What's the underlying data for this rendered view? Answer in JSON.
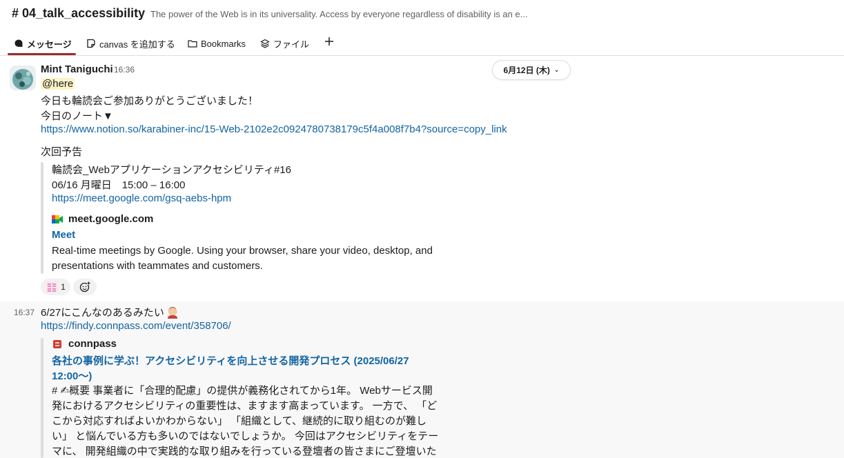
{
  "header": {
    "channel_title": "# 04_talk_accessibility",
    "channel_description": "The power of the Web is in its universality. Access by everyone regardless of disability is an e..."
  },
  "tabs": [
    {
      "label": "メッセージ",
      "icon": "message-icon"
    },
    {
      "label": "canvas を追加する",
      "icon": "canvas-icon"
    },
    {
      "label": "Bookmarks",
      "icon": "folder-icon"
    },
    {
      "label": "ファイル",
      "icon": "layers-icon"
    }
  ],
  "date_pill": "6月12日 (木)",
  "message1": {
    "sender": "Mint Taniguchi",
    "time": "16:36",
    "mention": "@here",
    "line1": "今日も輪読会ご参加ありがとうございました！",
    "line2": "今日のノート▼",
    "notion_link": "https://www.notion.so/karabiner-inc/15-Web-2102e2c0924780738179c5f4a008f7b4?source=copy_link",
    "next_label": "次回予告",
    "quote": {
      "title": "輪読会_Webアプリケーションアクセシビリティ#16",
      "datetime": "06/16 月曜日　15:00 – 16:00",
      "meet_link": "https://meet.google.com/gsq-aebs-hpm"
    },
    "unfurl": {
      "domain": "meet.google.com",
      "title": "Meet",
      "description": "Real-time meetings by Google. Using your browser, share your video, desktop, and presentations with teammates and customers."
    },
    "reaction": {
      "count": "1",
      "icon": "custom-emoji-icon"
    }
  },
  "message2": {
    "time": "16:37",
    "text": "6/27にこんなのあるみたい",
    "link": "https://findy.connpass.com/event/358706/",
    "unfurl": {
      "domain": "connpass",
      "title": "各社の事例に学ぶ！アクセシビリティを向上させる開発プロセス (2025/06/27 12:00〜)",
      "description": "# ✍概要 事業者に「合理的配慮」の提供が義務化されてから1年。 Webサービス開発におけるアクセシビリティの重要性は、ますます高まっています。 一方で、 「どこから対応すればよいかわからない」 「組織として、継続的に取り組むのが難しい」 と悩んでいる方も多いのではないでしょうか。 今回はアクセシビリティをテーマに、 開発組織の中で実践的な取り組みを行っている登壇者の皆さまにご登壇いた"
    }
  }
}
